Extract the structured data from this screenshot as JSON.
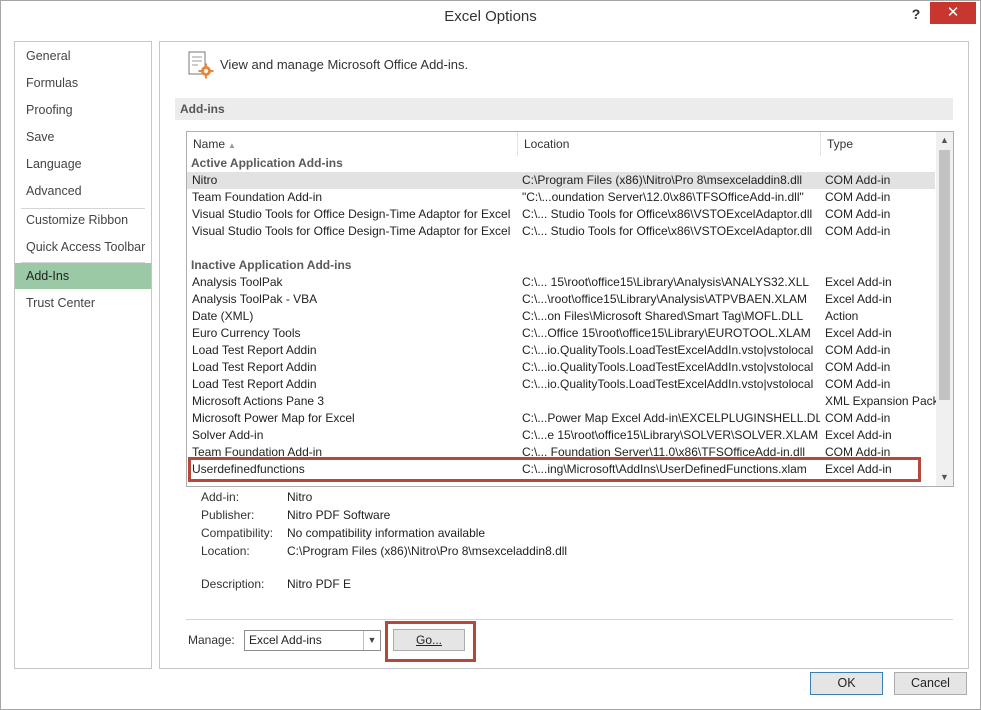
{
  "window": {
    "title": "Excel Options",
    "help": "?",
    "close": "✕"
  },
  "nav": {
    "items": [
      {
        "label": "General"
      },
      {
        "label": "Formulas"
      },
      {
        "label": "Proofing"
      },
      {
        "label": "Save"
      },
      {
        "label": "Language"
      },
      {
        "label": "Advanced"
      },
      {
        "label": "Customize Ribbon"
      },
      {
        "label": "Quick Access Toolbar"
      },
      {
        "label": "Add-Ins"
      },
      {
        "label": "Trust Center"
      }
    ],
    "selected": "Add-Ins"
  },
  "header": {
    "text": "View and manage Microsoft Office Add-ins.",
    "icon": "addins-gear-icon"
  },
  "section_title": "Add-ins",
  "table": {
    "columns": [
      "Name",
      "Location",
      "Type"
    ],
    "sort_column": "Name",
    "active_group": "Active Application Add-ins",
    "active_rows": [
      {
        "name": "Nitro",
        "location": "C:\\Program Files (x86)\\Nitro\\Pro 8\\msexceladdin8.dll",
        "type": "COM Add-in"
      },
      {
        "name": "Team Foundation Add-in",
        "location": "\"C:\\...oundation Server\\12.0\\x86\\TFSOfficeAdd-in.dll\"",
        "type": "COM Add-in"
      },
      {
        "name": "Visual Studio Tools for Office Design-Time Adaptor for Excel",
        "location": "C:\\... Studio Tools for Office\\x86\\VSTOExcelAdaptor.dll",
        "type": "COM Add-in"
      },
      {
        "name": "Visual Studio Tools for Office Design-Time Adaptor for Excel",
        "location": "C:\\... Studio Tools for Office\\x86\\VSTOExcelAdaptor.dll",
        "type": "COM Add-in"
      }
    ],
    "inactive_group": "Inactive Application Add-ins",
    "inactive_rows": [
      {
        "name": "Analysis ToolPak",
        "location": "C:\\... 15\\root\\office15\\Library\\Analysis\\ANALYS32.XLL",
        "type": "Excel Add-in"
      },
      {
        "name": "Analysis ToolPak - VBA",
        "location": "C:\\...\\root\\office15\\Library\\Analysis\\ATPVBAEN.XLAM",
        "type": "Excel Add-in"
      },
      {
        "name": "Date (XML)",
        "location": "C:\\...on Files\\Microsoft Shared\\Smart Tag\\MOFL.DLL",
        "type": "Action"
      },
      {
        "name": "Euro Currency Tools",
        "location": "C:\\...Office 15\\root\\office15\\Library\\EUROTOOL.XLAM",
        "type": "Excel Add-in"
      },
      {
        "name": "Load Test Report Addin",
        "location": "C:\\...io.QualityTools.LoadTestExcelAddIn.vsto|vstolocal",
        "type": "COM Add-in"
      },
      {
        "name": "Load Test Report Addin",
        "location": "C:\\...io.QualityTools.LoadTestExcelAddIn.vsto|vstolocal",
        "type": "COM Add-in"
      },
      {
        "name": "Load Test Report Addin",
        "location": "C:\\...io.QualityTools.LoadTestExcelAddIn.vsto|vstolocal",
        "type": "COM Add-in"
      },
      {
        "name": "Microsoft Actions Pane 3",
        "location": "",
        "type": "XML Expansion Pack"
      },
      {
        "name": "Microsoft Power Map for Excel",
        "location": "C:\\...Power Map Excel Add-in\\EXCELPLUGINSHELL.DLL",
        "type": "COM Add-in"
      },
      {
        "name": "Solver Add-in",
        "location": "C:\\...e 15\\root\\office15\\Library\\SOLVER\\SOLVER.XLAM",
        "type": "Excel Add-in"
      },
      {
        "name": "Team Foundation Add-in",
        "location": "C:\\... Foundation Server\\11.0\\x86\\TFSOfficeAdd-in.dll",
        "type": "COM Add-in"
      },
      {
        "name": "Userdefinedfunctions",
        "location": "C:\\...ing\\Microsoft\\AddIns\\UserDefinedFunctions.xlam",
        "type": "Excel Add-in"
      }
    ]
  },
  "details": {
    "addin_label": "Add-in:",
    "addin_value": "Nitro",
    "publisher_label": "Publisher:",
    "publisher_value": "Nitro PDF Software",
    "compat_label": "Compatibility:",
    "compat_value": "No compatibility information available",
    "location_label": "Location:",
    "location_value": "C:\\Program Files (x86)\\Nitro\\Pro 8\\msexceladdin8.dll",
    "description_label": "Description:",
    "description_value": "Nitro PDF E"
  },
  "manage": {
    "label": "Manage:",
    "selected": "Excel Add-ins",
    "go": "Go..."
  },
  "buttons": {
    "ok": "OK",
    "cancel": "Cancel"
  },
  "colors": {
    "highlight": "#b5483a",
    "nav_selected": "#9bc9a6",
    "close": "#c7372f"
  }
}
